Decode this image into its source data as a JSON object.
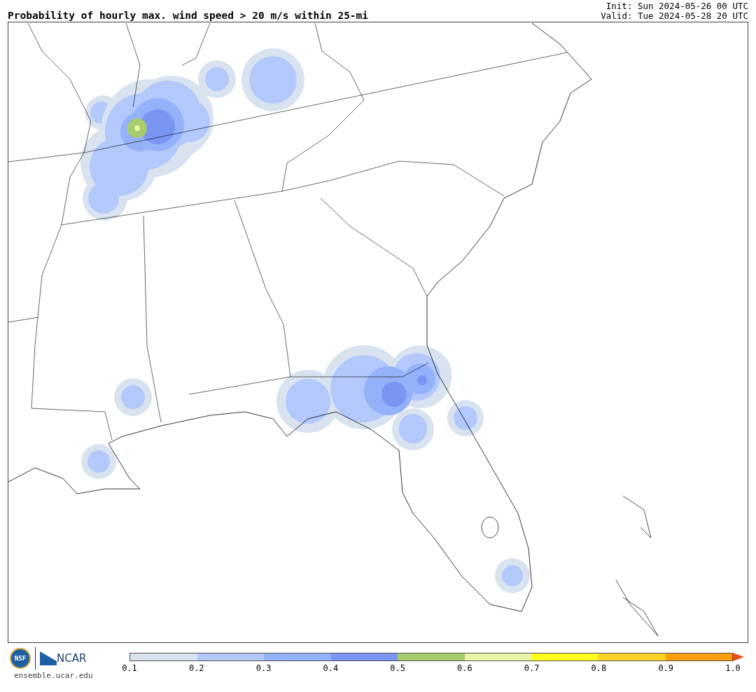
{
  "title": "Probability of hourly max. wind speed > 20 m/s within 25-mi",
  "init": "Init: Sun 2024-05-26 00 UTC",
  "valid": "Valid: Tue 2024-05-28 20 UTC",
  "logos": {
    "nsf": "NSF",
    "ncar": "NCAR"
  },
  "website": "ensemble.ucar.edu",
  "colorbar": {
    "bins": [
      {
        "color": "#d9e3ef"
      },
      {
        "color": "#b3c8fb"
      },
      {
        "color": "#94b2f9"
      },
      {
        "color": "#7b95f3"
      },
      {
        "color": "#a7cc6b"
      },
      {
        "color": "#e8f5a8"
      },
      {
        "color": "#fdfc1a"
      },
      {
        "color": "#fdd225"
      },
      {
        "color": "#fc9e0c"
      }
    ],
    "extension": {
      "kind": "arrow",
      "color": "#e8501a"
    },
    "ticks": [
      "0.1",
      "0.2",
      "0.3",
      "0.4",
      "0.5",
      "0.6",
      "0.7",
      "0.8",
      "0.9",
      "1.0"
    ]
  }
}
